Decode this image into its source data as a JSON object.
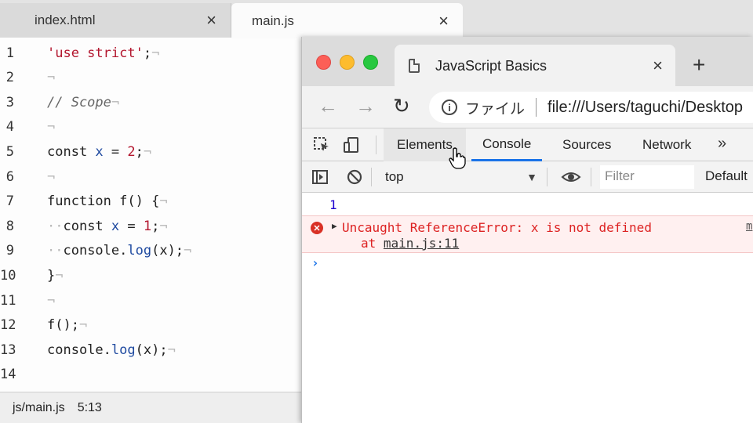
{
  "editor": {
    "tabs": [
      {
        "label": "index.html",
        "close": "×"
      },
      {
        "label": "main.js",
        "close": "×"
      }
    ],
    "lines": [
      {
        "n": "1",
        "html": [
          [
            "str",
            "'use strict'"
          ],
          [
            "kw",
            ";"
          ],
          [
            "inv",
            "¬"
          ]
        ]
      },
      {
        "n": "2",
        "html": [
          [
            "inv",
            "¬"
          ]
        ]
      },
      {
        "n": "3",
        "html": [
          [
            "cmt",
            "// Scope"
          ],
          [
            "inv",
            "¬"
          ]
        ]
      },
      {
        "n": "4",
        "html": [
          [
            "inv",
            "¬"
          ]
        ]
      },
      {
        "n": "5",
        "html": [
          [
            "kw",
            "const "
          ],
          [
            "id",
            "x"
          ],
          [
            "kw",
            " = "
          ],
          [
            "num",
            "2"
          ],
          [
            "kw",
            ";"
          ],
          [
            "inv",
            "¬"
          ]
        ]
      },
      {
        "n": "6",
        "html": [
          [
            "inv",
            "¬"
          ]
        ]
      },
      {
        "n": "7",
        "html": [
          [
            "kw",
            "function "
          ],
          [
            "kw",
            "f() {"
          ],
          [
            "inv",
            "¬"
          ]
        ]
      },
      {
        "n": "8",
        "html": [
          [
            "inv",
            "··"
          ],
          [
            "kw",
            "const "
          ],
          [
            "id",
            "x"
          ],
          [
            "kw",
            " = "
          ],
          [
            "num",
            "1"
          ],
          [
            "kw",
            ";"
          ],
          [
            "inv",
            "¬"
          ]
        ]
      },
      {
        "n": "9",
        "html": [
          [
            "inv",
            "··"
          ],
          [
            "kw",
            "console."
          ],
          [
            "id",
            "log"
          ],
          [
            "kw",
            "(x);"
          ],
          [
            "inv",
            "¬"
          ]
        ]
      },
      {
        "n": "10",
        "html": [
          [
            "kw",
            "}"
          ],
          [
            "inv",
            "¬"
          ]
        ]
      },
      {
        "n": "11",
        "html": [
          [
            "inv",
            "¬"
          ]
        ]
      },
      {
        "n": "12",
        "html": [
          [
            "kw",
            "f();"
          ],
          [
            "inv",
            "¬"
          ]
        ]
      },
      {
        "n": "13",
        "html": [
          [
            "kw",
            "console."
          ],
          [
            "id",
            "log"
          ],
          [
            "kw",
            "(x);"
          ],
          [
            "inv",
            "¬"
          ]
        ]
      },
      {
        "n": "14",
        "html": []
      }
    ],
    "status": {
      "path": "js/main.js",
      "position": "5:13"
    }
  },
  "browser": {
    "tab_title": "JavaScript Basics",
    "tab_close": "×",
    "new_tab": "+",
    "nav": {
      "back": "←",
      "forward": "→",
      "reload": "↻"
    },
    "omnibox": {
      "info": "i",
      "label": "ファイル",
      "url": "file:///Users/taguchi/Desktop"
    },
    "devtools": {
      "tabs": [
        "Elements",
        "Console",
        "Sources",
        "Network"
      ],
      "active_tab": "Console",
      "hover_tab": "Elements",
      "more": "»",
      "context": "top",
      "filter_placeholder": "Filter",
      "levels": "Default",
      "console": {
        "output_value": "1",
        "error_message": "Uncaught ReferenceError: x is not defined",
        "error_at_prefix": "at ",
        "error_link": "main.js:11",
        "error_source": "m",
        "prompt": "›"
      }
    }
  },
  "colors": {
    "string": "#b3162e",
    "identifier": "#1f4aa0",
    "error": "#d22222",
    "accent": "#1a73e8"
  }
}
